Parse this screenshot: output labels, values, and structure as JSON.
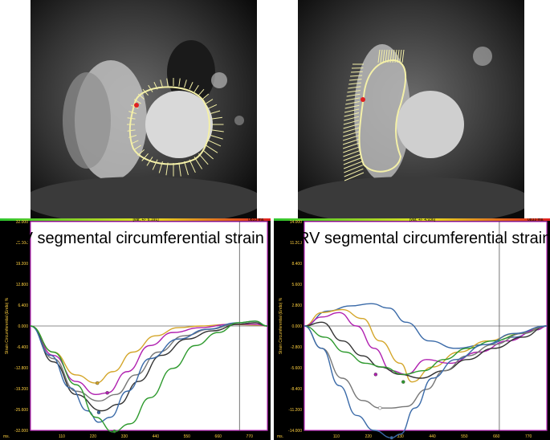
{
  "figure": {
    "left": {
      "title": "LV segmental circumferential strain",
      "var_label": "[var, +/- 6.191]",
      "time_label": "0833 ms.",
      "ylabel": "Strain Circumferential (Endo) %",
      "xunit": "ms."
    },
    "right": {
      "title": "RV segmental circumferential strain",
      "var_label": "[var, +/- 4.936]",
      "time_label": "0833 ms.",
      "ylabel": "Strain Circumferential (Endo) %",
      "xunit": "ms."
    }
  },
  "chart_data": [
    {
      "type": "line",
      "title": "LV segmental circumferential strain",
      "ylabel": "Strain Circumferential (Endo) %",
      "xlabel": "ms.",
      "xticks": [
        110,
        220,
        330,
        440,
        550,
        660,
        770
      ],
      "yticks": [
        "32.000",
        "25.600",
        "19.200",
        "12.800",
        "6.400",
        "0.000",
        "-6.400",
        "-12.800",
        "-19.200",
        "-25.600",
        "-32.000"
      ],
      "xlim": [
        0,
        833
      ],
      "ylim": [
        -32,
        32
      ],
      "marker_time": 735,
      "series": [
        {
          "color": "#d4a62a",
          "x": [
            0,
            80,
            160,
            230,
            290,
            360,
            440,
            520,
            600,
            700,
            790,
            833
          ],
          "y": [
            0,
            -8,
            -15,
            -17.5,
            -14,
            -8,
            -3,
            -0.5,
            0,
            0.5,
            0.3,
            0
          ]
        },
        {
          "color": "#b020b0",
          "x": [
            0,
            80,
            160,
            230,
            270,
            340,
            420,
            500,
            600,
            700,
            790,
            833
          ],
          "y": [
            0,
            -9,
            -17,
            -21,
            -20.5,
            -14,
            -6,
            -2,
            -0.5,
            0.5,
            0.5,
            0
          ]
        },
        {
          "color": "#777777",
          "x": [
            0,
            80,
            160,
            240,
            300,
            370,
            450,
            540,
            630,
            720,
            790,
            833
          ],
          "y": [
            0,
            -10,
            -20,
            -23,
            -21,
            -15,
            -8,
            -3,
            -1,
            0.5,
            1,
            0
          ]
        },
        {
          "color": "#333333",
          "x": [
            0,
            80,
            160,
            250,
            310,
            380,
            460,
            550,
            640,
            730,
            790,
            833
          ],
          "y": [
            0,
            -11,
            -21,
            -26,
            -24,
            -17,
            -9,
            -4,
            -1.5,
            0.5,
            1,
            0
          ]
        },
        {
          "color": "#3a6aa8",
          "x": [
            0,
            70,
            140,
            200,
            240,
            280,
            340,
            420,
            520,
            620,
            730,
            790,
            833
          ],
          "y": [
            0,
            -9,
            -19,
            -26,
            -29.5,
            -28,
            -20,
            -10,
            -4,
            -1,
            1,
            1.5,
            0
          ]
        },
        {
          "color": "#2e9a2e",
          "x": [
            0,
            80,
            160,
            230,
            290,
            350,
            420,
            500,
            580,
            660,
            730,
            790,
            833
          ],
          "y": [
            0,
            -8,
            -18,
            -28,
            -32.5,
            -30,
            -22,
            -13,
            -6,
            -2,
            1,
            1.5,
            0
          ]
        }
      ],
      "points": [
        {
          "color": "#d4a62a",
          "x": 235,
          "y": -17.5
        },
        {
          "color": "#b020b0",
          "x": 270,
          "y": -20.5
        },
        {
          "color": "#3a6aa8",
          "x": 240,
          "y": -26.5
        },
        {
          "color": "#2e9a2e",
          "x": 295,
          "y": -32.3
        }
      ]
    },
    {
      "type": "line",
      "title": "RV segmental circumferential strain",
      "ylabel": "Strain Circumferential (Endo) %",
      "xlabel": "ms.",
      "xticks": [
        110,
        220,
        330,
        440,
        550,
        660,
        770
      ],
      "yticks": [
        "14.000",
        "11.200",
        "8.400",
        "5.600",
        "2.800",
        "0.000",
        "-2.800",
        "-5.600",
        "-8.400",
        "-11.200",
        "-14.000"
      ],
      "xlim": [
        0,
        833
      ],
      "ylim": [
        -14,
        14
      ],
      "marker_time": 670,
      "series": [
        {
          "color": "#3a6aa8",
          "x": [
            0,
            80,
            160,
            230,
            290,
            350,
            430,
            520,
            620,
            720,
            800,
            833
          ],
          "y": [
            0,
            2,
            2.7,
            3,
            2.4,
            0.5,
            -2,
            -3,
            -2.5,
            -1.5,
            -0.5,
            0
          ]
        },
        {
          "color": "#d4a62a",
          "x": [
            0,
            60,
            130,
            200,
            260,
            330,
            370,
            440,
            530,
            630,
            730,
            833
          ],
          "y": [
            0,
            1.8,
            2.2,
            1,
            -2,
            -5,
            -7.5,
            -5.5,
            -3.5,
            -2,
            -1,
            0
          ]
        },
        {
          "color": "#b020b0",
          "x": [
            0,
            60,
            120,
            180,
            240,
            300,
            350,
            420,
            500,
            600,
            700,
            800,
            833
          ],
          "y": [
            0,
            1.2,
            1.8,
            0,
            -3,
            -6,
            -6.5,
            -4.5,
            -5,
            -3.5,
            -2,
            -0.5,
            0
          ]
        },
        {
          "color": "#333333",
          "x": [
            0,
            60,
            130,
            200,
            260,
            330,
            400,
            480,
            560,
            650,
            750,
            833
          ],
          "y": [
            0,
            0.5,
            -2,
            -4,
            -5.5,
            -6.5,
            -7,
            -6,
            -4.5,
            -3,
            -1.5,
            0
          ]
        },
        {
          "color": "#2e9a2e",
          "x": [
            0,
            70,
            140,
            210,
            270,
            340,
            410,
            480,
            560,
            650,
            750,
            833
          ],
          "y": [
            0,
            -1.5,
            -3.5,
            -5,
            -5.5,
            -6.5,
            -6,
            -4.5,
            -3,
            -2,
            -1,
            0
          ]
        },
        {
          "color": "#777777",
          "x": [
            0,
            60,
            130,
            200,
            260,
            300,
            350,
            420,
            480,
            560,
            650,
            750,
            833
          ],
          "y": [
            0,
            -3,
            -7,
            -10,
            -11,
            -11,
            -10.8,
            -8.5,
            -6,
            -4,
            -2.5,
            -1,
            0
          ]
        },
        {
          "color": "#3a6aa8",
          "x": [
            0,
            60,
            120,
            180,
            240,
            300,
            330,
            380,
            440,
            520,
            620,
            720,
            833
          ],
          "y": [
            0,
            -3,
            -8,
            -12,
            -14,
            -15,
            -14.5,
            -11,
            -7,
            -4.5,
            -2.5,
            -1,
            0
          ]
        }
      ],
      "points": [
        {
          "color": "#b020b0",
          "x": 245,
          "y": -6.5
        },
        {
          "color": "#2e9a2e",
          "x": 340,
          "y": -7.5
        },
        {
          "color": "#ffffff",
          "x": 260,
          "y": -11
        },
        {
          "color": "#3a6aa8",
          "x": 300,
          "y": -15
        }
      ]
    }
  ]
}
